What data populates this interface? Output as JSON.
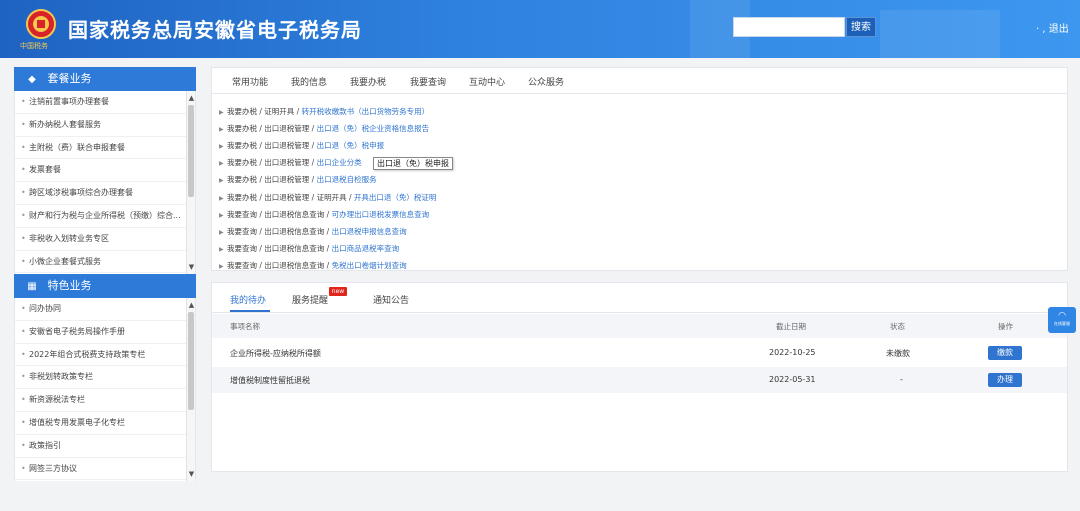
{
  "header": {
    "title": "国家税务总局安徽省电子税务局",
    "logo_text": "中国税务",
    "search_placeholder": "",
    "search_label": "搜索",
    "exit_label": "退出",
    "exit_prefix": "· ,",
    "accent_color": "#2f74cf"
  },
  "sidebar": {
    "section1": {
      "title": "套餐业务",
      "icon": "package-icon",
      "items": [
        "注销前置事项办理套餐",
        "新办纳税人套餐服务",
        "主附税（费）联合申报套餐",
        "发票套餐",
        "跨区域涉税事项综合办理套餐",
        "财产和行为税与企业所得税（预缴）综合...",
        "非税收入划转业务专区",
        "小微企业套餐式服务"
      ]
    },
    "section2": {
      "title": "特色业务",
      "icon": "grid-icon",
      "items": [
        "问办协同",
        "安徽省电子税务局操作手册",
        "2022年组合式税费支持政策专栏",
        "非税划转政策专栏",
        "新资源税法专栏",
        "增值税专用发票电子化专栏",
        "政策指引",
        "网签三方协议"
      ]
    }
  },
  "top_panel": {
    "tabs": [
      "常用功能",
      "我的信息",
      "我要办税",
      "我要查询",
      "互动中心",
      "公众服务"
    ],
    "links": [
      {
        "path": "我要办税 / 证明开具 / ",
        "target": "转开税收缴款书（出口货物劳务专用）"
      },
      {
        "path": "我要办税 / 出口退税管理 / ",
        "target": "出口退（免）税企业资格信息报告"
      },
      {
        "path": "我要办税 / 出口退税管理 / ",
        "target": "出口退（免）税申报"
      },
      {
        "path": "我要办税 / 出口退税管理 / ",
        "target": "出口企业分类"
      },
      {
        "path": "我要办税 / 出口退税管理 / ",
        "target": "出口退税自检服务"
      },
      {
        "path": "我要办税 / 出口退税管理 / 证明开具 / ",
        "target": "开具出口退（免）税证明"
      },
      {
        "path": "我要查询 / 出口退税信息查询 / ",
        "target": "可办理出口退税发票信息查询"
      },
      {
        "path": "我要查询 / 出口退税信息查询 / ",
        "target": "出口退税申报信息查询"
      },
      {
        "path": "我要查询 / 出口退税信息查询 / ",
        "target": "出口商品退税率查询"
      },
      {
        "path": "我要查询 / 出口退税信息查询 / ",
        "target": "免税出口卷烟计划查询"
      }
    ],
    "tooltip": "出口退（免）税申报"
  },
  "todo_panel": {
    "tabs": [
      "我的待办",
      "服务提醒",
      "通知公告"
    ],
    "new_badge": "new",
    "columns": [
      "事项名称",
      "截止日期",
      "状态",
      "操作"
    ],
    "rows": [
      {
        "name": "企业所得税-应纳税所得额",
        "deadline": "2022-10-25",
        "status": "未缴款",
        "action": "缴款"
      },
      {
        "name": "增值税制度性留抵退税",
        "deadline": "2022-05-31",
        "status": "-",
        "action": "办理"
      }
    ]
  },
  "float": {
    "label": "在线客服"
  }
}
